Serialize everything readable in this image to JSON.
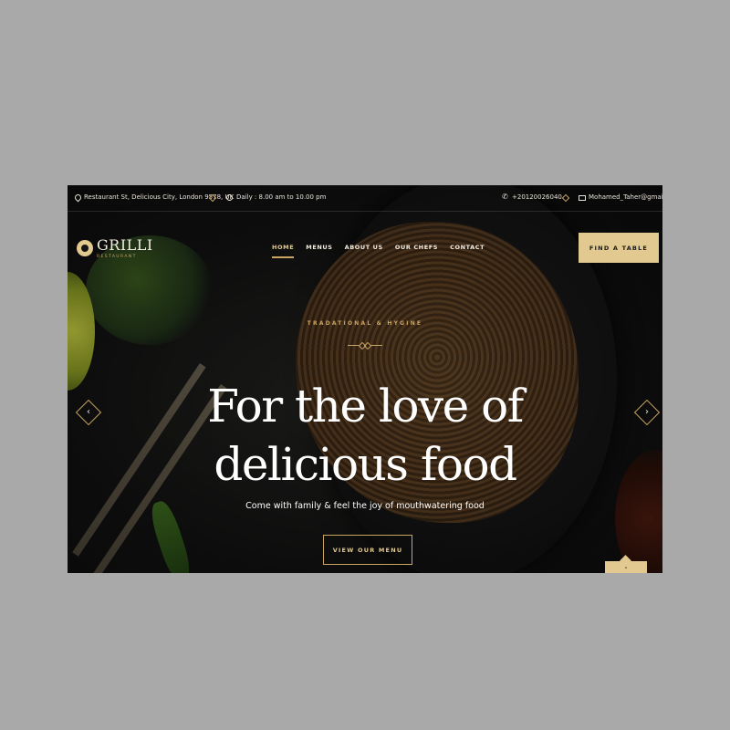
{
  "topbar": {
    "address": "Restaurant St, Delicious City, London 9578, UK",
    "hours": "Daily : 8.00 am to 10.00 pm",
    "phone": "+20120026040",
    "email": "Mohamed_Taher@gmail.com"
  },
  "logo": {
    "name": "GRILLI",
    "tagline": "RESTAURANT"
  },
  "nav": {
    "items": [
      "HOME",
      "MENUS",
      "ABOUT US",
      "OUR CHEFS",
      "CONTACT"
    ],
    "active": "HOME"
  },
  "header": {
    "cta_label": "FIND A TABLE"
  },
  "hero": {
    "kicker": "TRADATIONAL & HYGINE",
    "title_line1": "For the love of",
    "title_line2": "delicious food",
    "subtitle": "Come with family & feel the joy of mouthwatering food",
    "button_label": "VIEW OUR MENU"
  },
  "slider": {
    "prev_icon": "chevron-left-icon",
    "next_icon": "chevron-right-icon"
  },
  "colors": {
    "accent": "#c9a463",
    "accent_light": "#e2c98f",
    "background": "#121212",
    "text": "#ffffff"
  }
}
